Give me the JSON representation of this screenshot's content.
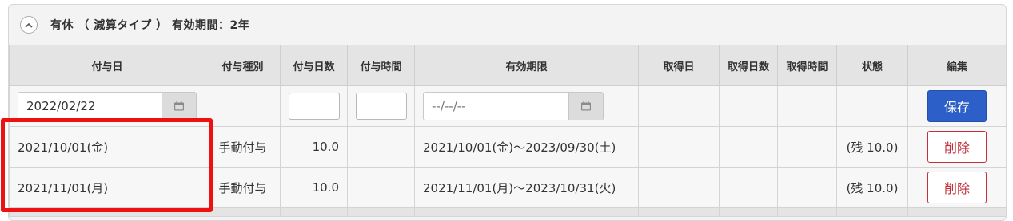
{
  "panel": {
    "title": "有休 （ 減算タイプ ） 有効期間：2年"
  },
  "table": {
    "headers": [
      "付与日",
      "付与種別",
      "付与日数",
      "付与時間",
      "有効期限",
      "取得日",
      "取得日数",
      "取得時間",
      "状態",
      "編集"
    ],
    "input_row": {
      "grant_date_value": "2022/02/22",
      "expiry_placeholder": "--/--/--",
      "save_label": "保存"
    },
    "rows": [
      {
        "grant_date": "2021/10/01(金)",
        "grant_type": "手動付与",
        "days": "10.0",
        "hours": "",
        "expiry": "2021/10/01(金)～2023/09/30(土)",
        "taken_date": "",
        "taken_days": "",
        "taken_hours": "",
        "status": "(残 10.0)",
        "delete_label": "削除"
      },
      {
        "grant_date": "2021/11/01(月)",
        "grant_type": "手動付与",
        "days": "10.0",
        "hours": "",
        "expiry": "2021/11/01(月)～2023/10/31(火)",
        "taken_date": "",
        "taken_days": "",
        "taken_hours": "",
        "status": "(残 10.0)",
        "delete_label": "削除"
      }
    ]
  },
  "colors": {
    "primary_button": "#2c5fc7",
    "danger": "#c3303a",
    "highlight": "#ee1111"
  }
}
